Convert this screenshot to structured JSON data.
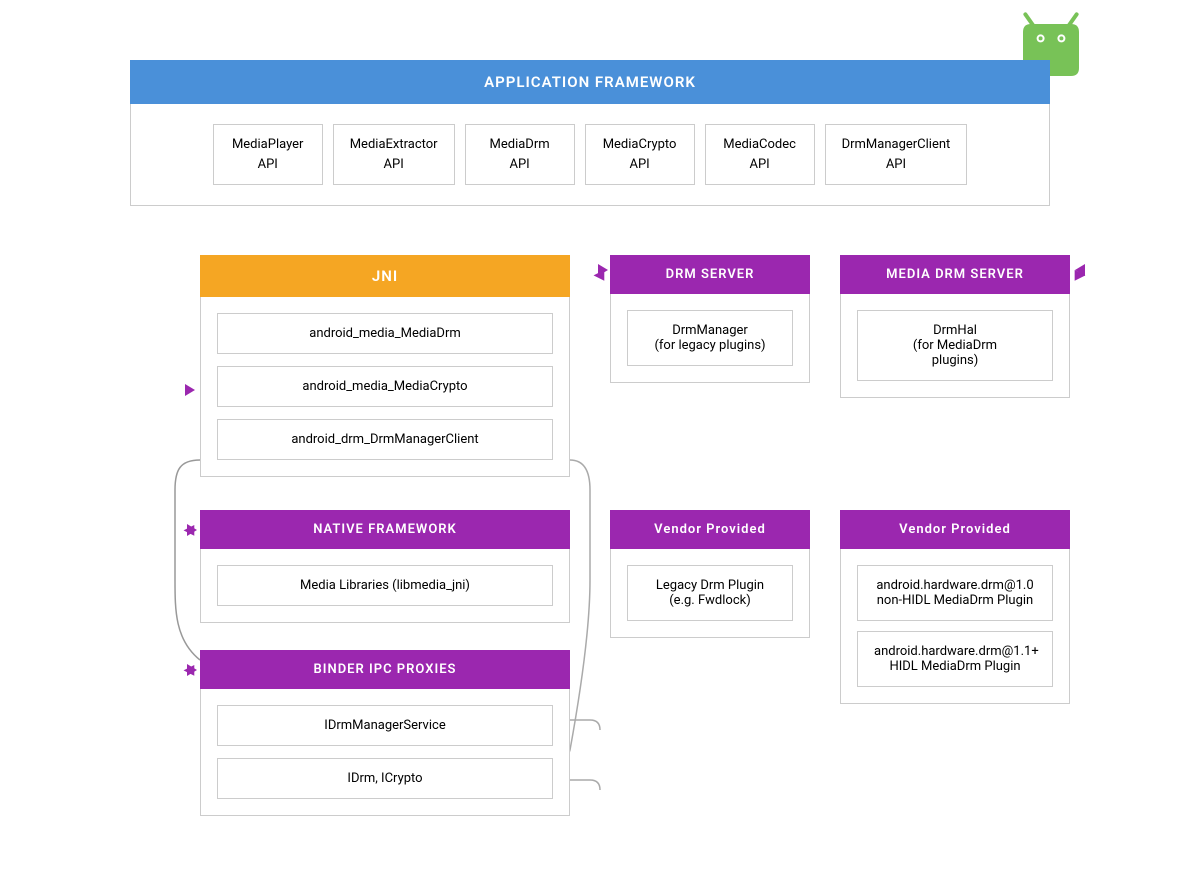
{
  "android_logo": {
    "color_body": "#78C257",
    "color_eye": "white",
    "alt": "Android Logo"
  },
  "app_framework": {
    "header": "APPLICATION FRAMEWORK",
    "apis": [
      {
        "name": "MediaPlayer\nAPI"
      },
      {
        "name": "MediaExtractor\nAPI"
      },
      {
        "name": "MediaDrm\nAPI"
      },
      {
        "name": "MediaCrypto\nAPI"
      },
      {
        "name": "MediaCodec\nAPI"
      },
      {
        "name": "DrmManagerClient\nAPI"
      }
    ]
  },
  "jni_section": {
    "header": "JNI",
    "items": [
      "android_media_MediaDrm",
      "android_media_MediaCrypto",
      "android_drm_DrmManagerClient"
    ]
  },
  "drm_server_section": {
    "header": "DRM SERVER",
    "items": [
      "DrmManager\n(for legacy plugins)"
    ]
  },
  "media_drm_server_section": {
    "header": "MEDIA DRM SERVER",
    "items": [
      "DrmHal\n(for MediaDrm\nplugins)"
    ]
  },
  "native_framework_section": {
    "header": "NATIVE FRAMEWORK",
    "items": [
      "Media Libraries (libmedia_jni)"
    ]
  },
  "vendor_left_section": {
    "header": "Vendor Provided",
    "items": [
      "Legacy Drm Plugin\n(e.g. Fwdlock)"
    ]
  },
  "vendor_right_section": {
    "header": "Vendor Provided",
    "items": [
      "android.hardware.drm@1.0\nnon-HIDL MediaDrm Plugin",
      "android.hardware.drm@1.1+\nHIDL MediaDrm Plugin"
    ]
  },
  "binder_section": {
    "header": "BINDER IPC PROXIES",
    "items": [
      "IDrmManagerService",
      "IDrm, ICrypto"
    ]
  },
  "colors": {
    "app_framework_header": "#4A90D9",
    "jni_header": "#F5A623",
    "purple_header": "#9B27AF",
    "border": "#cccccc",
    "white": "#ffffff"
  }
}
